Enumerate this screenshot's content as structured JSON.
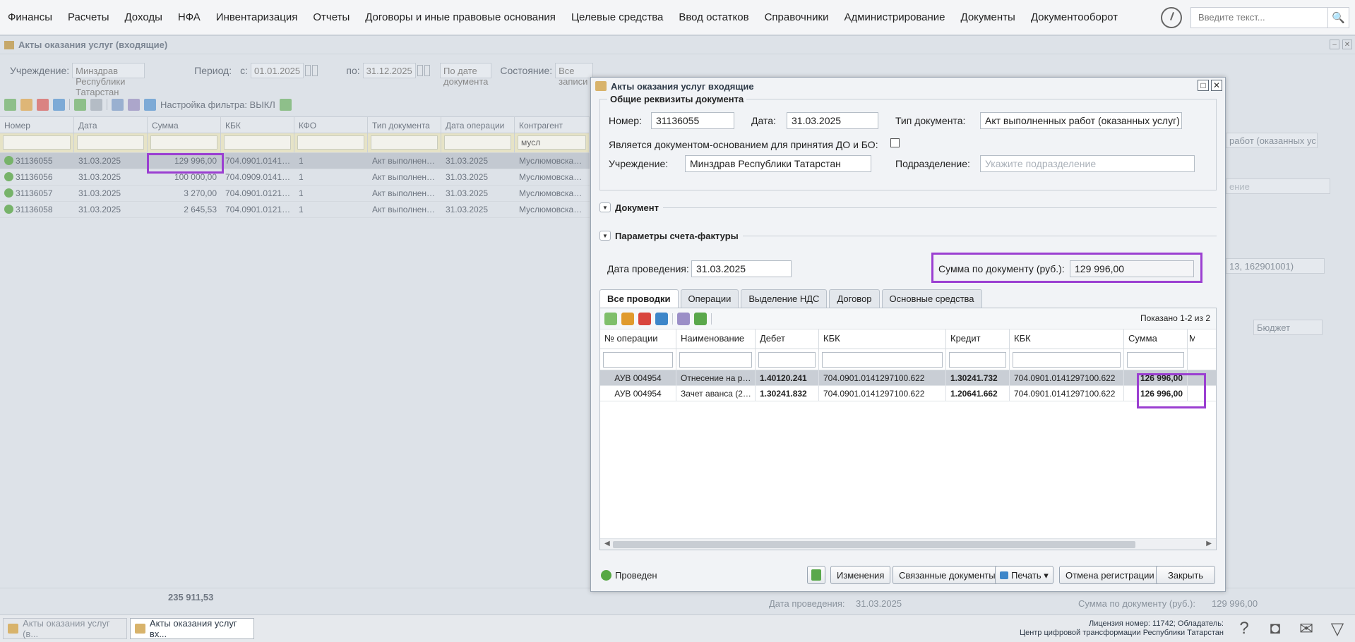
{
  "menu": [
    "Финансы",
    "Расчеты",
    "Доходы",
    "НФА",
    "Инвентаризация",
    "Отчеты",
    "Договоры и иные правовые основания",
    "Целевые средства",
    "Ввод остатков",
    "Справочники",
    "Администрирование",
    "Документы",
    "Документооборот"
  ],
  "search": {
    "placeholder": "Введите текст..."
  },
  "bg": {
    "title": "Акты оказания услуг (входящие)",
    "filters": {
      "institution_label": "Учреждение:",
      "institution_value": "Минздрав Республики Татарстан",
      "period_label": "Период:",
      "from_label": "с:",
      "from_value": "01.01.2025",
      "to_label": "по:",
      "to_value": "31.12.2025",
      "date_mode": "По дате документа",
      "state_label": "Состояние:",
      "state_value": "Все записи"
    },
    "filter_setting": "Настройка фильтра: ВЫКЛ",
    "columns": [
      "Номер",
      "Дата",
      "Сумма",
      "КБК",
      "КФО",
      "Тип документа",
      "Дата операции",
      "Контрагент"
    ],
    "contractor_filter": "мусл",
    "rows": [
      {
        "num": "31136055",
        "date": "31.03.2025",
        "sum": "129 996,00",
        "kbk": "704.0901.0141…",
        "kfo": "1",
        "type": "Акт выполнен…",
        "opdate": "31.03.2025",
        "contractor": "Муслюмовска…"
      },
      {
        "num": "31136056",
        "date": "31.03.2025",
        "sum": "100 000,00",
        "kbk": "704.0909.0141…",
        "kfo": "1",
        "type": "Акт выполнен…",
        "opdate": "31.03.2025",
        "contractor": "Муслюмовска…"
      },
      {
        "num": "31136057",
        "date": "31.03.2025",
        "sum": "3 270,00",
        "kbk": "704.0901.0121…",
        "kfo": "1",
        "type": "Акт выполнен…",
        "opdate": "31.03.2025",
        "contractor": "Муслюмовска…"
      },
      {
        "num": "31136058",
        "date": "31.03.2025",
        "sum": "2 645,53",
        "kbk": "704.0901.0121…",
        "kfo": "1",
        "type": "Акт выполнен…",
        "opdate": "31.03.2025",
        "contractor": "Муслюмовска…"
      }
    ],
    "total": "235 911,53",
    "right_fragments": {
      "type_frag": "работ (оказанных ус",
      "placeholder_frag": "ение",
      "code_frag": "13, 162901001)",
      "budget": "Бюджет",
      "bottom_date_label": "Дата проведения:",
      "bottom_date_value": "31.03.2025",
      "bottom_sum_label": "Сумма по документу (руб.):",
      "bottom_sum_value": "129 996,00"
    }
  },
  "modal": {
    "title": "Акты оказания услуг входящие",
    "section_general": "Общие реквизиты документа",
    "number_label": "Номер:",
    "number_value": "31136055",
    "date_label": "Дата:",
    "date_value": "31.03.2025",
    "doctype_label": "Тип документа:",
    "doctype_value": "Акт выполненных работ (оказанных услуг)",
    "basis_label": "Является документом-основанием для принятия ДО и БО:",
    "institution_label": "Учреждение:",
    "institution_value": "Минздрав Республики Татарстан",
    "subdivision_label": "Подразделение:",
    "subdivision_placeholder": "Укажите подразделение",
    "section_document": "Документ",
    "section_invoice": "Параметры счета-фактуры",
    "posting_date_label": "Дата проведения:",
    "posting_date_value": "31.03.2025",
    "doc_sum_label": "Сумма по документу (руб.):",
    "doc_sum_value": "129 996,00",
    "tabs": [
      "Все проводки",
      "Операции",
      "Выделение НДС",
      "Договор",
      "Основные средства"
    ],
    "shown": "Показано 1-2 из 2",
    "grid_columns": [
      "№ операции",
      "Наименование",
      "Дебет",
      "КБК",
      "Кредит",
      "КБК",
      "Сумма",
      "М"
    ],
    "grid_rows": [
      {
        "op": "АУВ 004954",
        "name": "Отнесение на р…",
        "debit": "1.40120.241",
        "kbk1": "704.0901.0141297100.622",
        "credit": "1.30241.732",
        "kbk2": "704.0901.0141297100.622",
        "sum": "126 996,00"
      },
      {
        "op": "АУВ 004954",
        "name": "Зачет аванса (2…",
        "debit": "1.30241.832",
        "kbk1": "704.0901.0141297100.622",
        "credit": "1.20641.662",
        "kbk2": "704.0901.0141297100.622",
        "sum": "126 996,00"
      }
    ],
    "status": "Проведен",
    "buttons": {
      "changes": "Изменения",
      "related": "Связанные документы",
      "print": "Печать",
      "cancel_reg": "Отмена регистрации",
      "close": "Закрыть"
    }
  },
  "taskbar": {
    "tasks": [
      "Акты оказания услуг (в...",
      "Акты оказания услуг вх..."
    ],
    "license_line1": "Лицензия номер: 11742; Обладатель:",
    "license_line2": "Центр цифровой трансформации Республики Татарстан"
  },
  "colors": {
    "highlight": "#9b3fd1",
    "status_ok": "#56a843"
  }
}
